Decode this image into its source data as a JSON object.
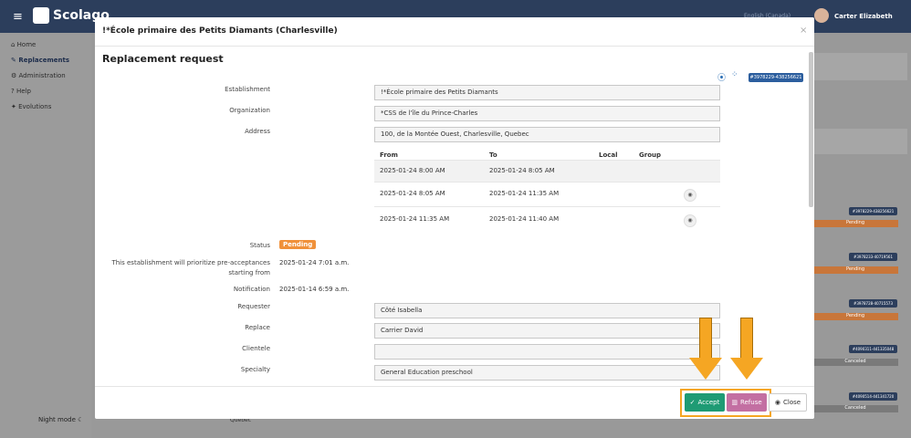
{
  "app": {
    "logo": "Scolago",
    "user": "Carter Elizabeth",
    "language": "English (Canada)",
    "night_mode": "Night mode",
    "bg_footer": "Quebec"
  },
  "sidebar": {
    "items": [
      "Home",
      "Replacements",
      "Administration",
      "Help",
      "Evolutions"
    ]
  },
  "modal": {
    "title": "!*École primaire des Petits Diamants (Charlesville)",
    "heading": "Replacement request",
    "id_badge": "#3978229-438256621",
    "close_icon": "×",
    "labels": {
      "establishment": "Establishment",
      "organization": "Organization",
      "address": "Address",
      "status": "Status",
      "prioritize": "This establishment will prioritize pre-acceptances starting from",
      "notification": "Notification",
      "requester": "Requester",
      "replace": "Replace",
      "clientele": "Clientele",
      "specialty": "Specialty"
    },
    "values": {
      "establishment": "!*École primaire des Petits Diamants",
      "organization": "*CSS de l'île du Prince-Charles",
      "address": "100, de la Montée Ouest, Charlesville, Quebec",
      "status": "Pending",
      "prioritize": "2025-01-24 7:01 a.m.",
      "notification": "2025-01-14 6:59 a.m.",
      "requester": "Côté Isabella",
      "replace": "Carrier David",
      "clientele": "",
      "specialty": "General Education preschool"
    },
    "table": {
      "headers": [
        "From",
        "To",
        "Local",
        "Group"
      ],
      "rows": [
        {
          "from": "2025-01-24 8:00 AM",
          "to": "2025-01-24 8:05 AM"
        },
        {
          "from": "2025-01-24 8:05 AM",
          "to": "2025-01-24 11:35 AM"
        },
        {
          "from": "2025-01-24 11:35 AM",
          "to": "2025-01-24 11:40 AM"
        }
      ]
    },
    "buttons": {
      "accept": "Accept",
      "refuse": "Refuse",
      "close": "Close"
    }
  },
  "right_list": [
    {
      "id": "#3978229-438256621",
      "status": "Pending"
    },
    {
      "id": "#3978233-40719561",
      "status": "Pending"
    },
    {
      "id": "#3978728-40715573",
      "status": "Pending"
    },
    {
      "id": "#4090311-441335048",
      "status": "Canceled"
    },
    {
      "id": "#4090514-441341720",
      "status": "Canceled"
    }
  ],
  "colors": {
    "accent": "#2c3e5c",
    "pending": "#f0913a",
    "accept": "#1e9b74",
    "refuse": "#c36fa2",
    "arrow": "#f5a623"
  }
}
